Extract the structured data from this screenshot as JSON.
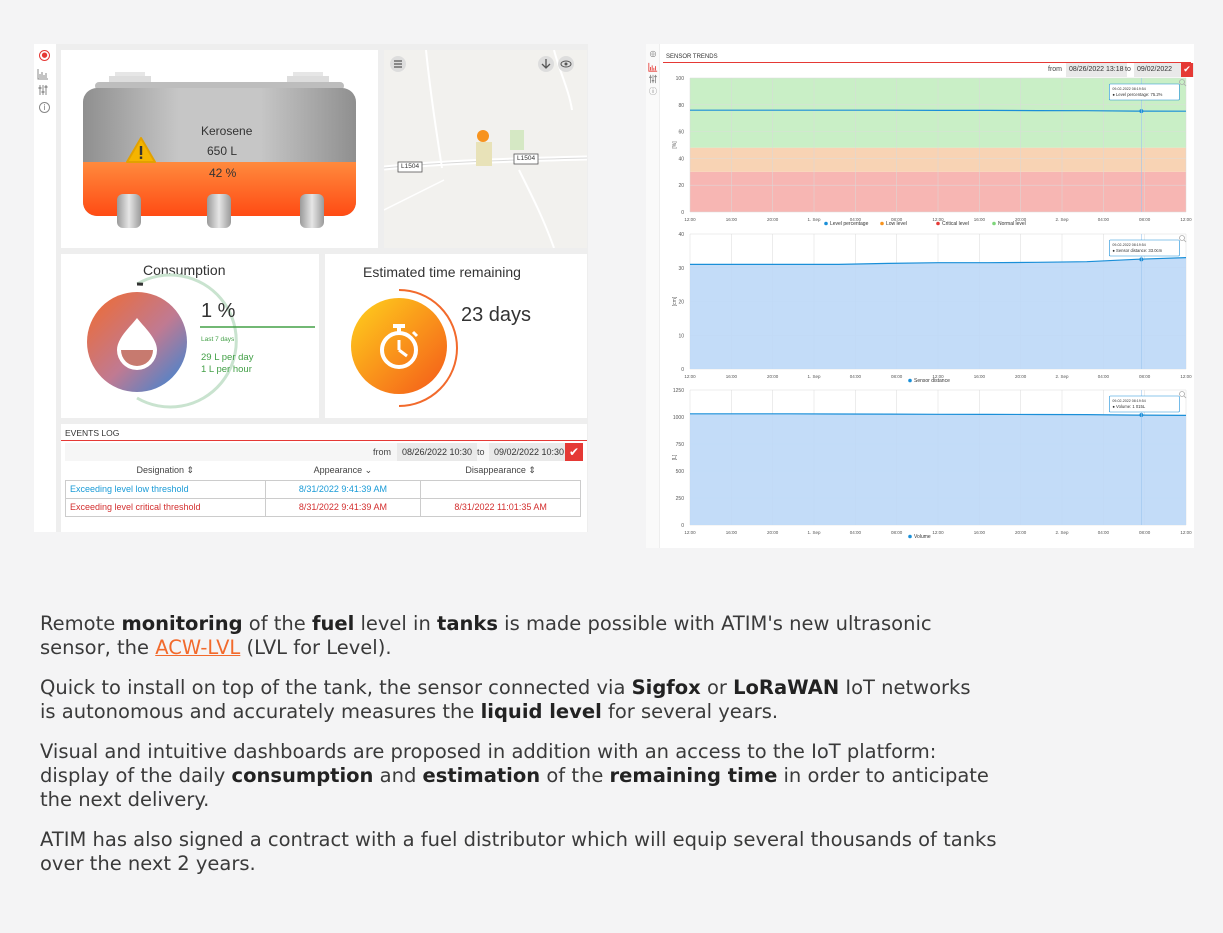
{
  "dashboard": {
    "tank": {
      "product": "Kerosene",
      "volume": "650 L",
      "percent": "42 %",
      "fill_fraction": 0.42
    },
    "map": {
      "road_label_1": "L1504",
      "road_label_2": "L1504"
    },
    "consumption": {
      "title": "Consumption",
      "percent": "1 %",
      "period": "Last 7 days",
      "per_day": "29 L per day",
      "per_hour": "1 L per hour"
    },
    "remaining": {
      "title": "Estimated time remaining",
      "value": "23 days"
    },
    "events": {
      "title": "EVENTS LOG",
      "from_label": "from",
      "from_value": "08/26/2022 10:30",
      "to_label": "to",
      "to_value": "09/02/2022 10:30",
      "columns": [
        "Designation ⇕",
        "Appearance ⌄",
        "Disappearance ⇕"
      ],
      "rows": [
        {
          "designation": "Exceeding level low threshold",
          "appearance": "8/31/2022 9:41:39 AM",
          "disappearance": "",
          "color": "#1a9bd7"
        },
        {
          "designation": "Exceeding level critical threshold",
          "appearance": "8/31/2022 9:41:39 AM",
          "disappearance": "8/31/2022 11:01:35 AM",
          "color": "#d32f2f"
        }
      ]
    }
  },
  "trends": {
    "title": "SENSOR TRENDS",
    "from_label": "from",
    "from_value": "08/26/2022 13:18",
    "to_label": "to",
    "to_value": "09/02/2022 13:18",
    "x_ticks": [
      "12:00",
      "16:00",
      "20:00",
      "1. Sep",
      "04:00",
      "08:00",
      "12:00",
      "16:00",
      "20:00",
      "2. Sep",
      "04:00",
      "08:00",
      "12:00"
    ]
  },
  "chart_data": [
    {
      "type": "line",
      "ylabel": "[%]",
      "ylim": [
        0,
        100
      ],
      "yticks": [
        0,
        20,
        40,
        60,
        80,
        100
      ],
      "bands": [
        {
          "from": 0,
          "to": 30,
          "color": "#f7b6b3"
        },
        {
          "from": 30,
          "to": 48,
          "color": "#f8d3b4"
        },
        {
          "from": 48,
          "to": 100,
          "color": "#c9efc6"
        }
      ],
      "x": [
        0,
        0.1,
        0.2,
        0.3,
        0.4,
        0.5,
        0.6,
        0.7,
        0.8,
        0.9,
        1
      ],
      "series": [
        {
          "name": "Level percentage",
          "values": [
            76,
            76,
            76,
            76,
            76,
            75.8,
            75.8,
            75.7,
            75.6,
            75.3,
            75.2
          ]
        }
      ],
      "legend": [
        "Level percentage",
        "Low level",
        "Critical level",
        "Normal level"
      ],
      "legend_colors": [
        "#1a8fd8",
        "#f7931e",
        "#e53935",
        "#7ed67a"
      ],
      "tooltip": [
        "09-02-2022 08:19:54",
        "● Level percentage: 75.2%"
      ]
    },
    {
      "type": "area",
      "ylabel": "[cm]",
      "ylim": [
        0,
        40
      ],
      "yticks": [
        0,
        10,
        20,
        30,
        40
      ],
      "x": [
        0,
        0.1,
        0.2,
        0.3,
        0.4,
        0.5,
        0.6,
        0.7,
        0.8,
        0.9,
        1
      ],
      "series": [
        {
          "name": "Sensor distance",
          "values": [
            31,
            31,
            31,
            31,
            31.3,
            31.5,
            31.5,
            31.6,
            31.8,
            32.5,
            33
          ]
        }
      ],
      "legend": [
        "Sensor distance"
      ],
      "legend_colors": [
        "#1a8fd8"
      ],
      "tooltip": [
        "09-02-2022 08:19:54",
        "● Sensor distance: 33.0cm"
      ]
    },
    {
      "type": "area",
      "ylabel": "[L]",
      "ylim": [
        0,
        1250
      ],
      "yticks": [
        0,
        250,
        500,
        750,
        1000,
        1250
      ],
      "x": [
        0,
        0.1,
        0.2,
        0.3,
        0.4,
        0.5,
        0.6,
        0.7,
        0.8,
        0.9,
        1
      ],
      "series": [
        {
          "name": "Volume",
          "values": [
            1030,
            1030,
            1030,
            1028,
            1027,
            1025,
            1024,
            1023,
            1022,
            1018,
            1015
          ]
        }
      ],
      "legend": [
        "Volume"
      ],
      "legend_colors": [
        "#1a8fd8"
      ],
      "tooltip": [
        "09-02-2022 08:19:54",
        "● Volume: 1 015L"
      ]
    }
  ],
  "article": {
    "lines": [
      [
        [
          "Remote ",
          false
        ],
        [
          "monitoring",
          true
        ],
        [
          " of the ",
          false
        ],
        [
          "fuel",
          true
        ],
        [
          " level in ",
          false
        ],
        [
          "tanks",
          true
        ],
        [
          " is made possible with ATIM's new ultrasonic",
          false
        ]
      ],
      [
        [
          "sensor, the ",
          false
        ],
        [
          "ACW-LVL",
          "link"
        ],
        [
          " (LVL for Level).",
          false
        ]
      ],
      [
        [
          "Quick to install on top of the tank, the sensor connected via ",
          false
        ],
        [
          "Sigfox",
          true
        ],
        [
          " or ",
          false
        ],
        [
          "LoRaWAN",
          true
        ],
        [
          " IoT networks",
          false
        ]
      ],
      [
        [
          "is autonomous and accurately measures the ",
          false
        ],
        [
          "liquid level",
          true
        ],
        [
          " for several years.",
          false
        ]
      ],
      [
        [
          "Visual and intuitive dashboards are proposed in addition with an access to the IoT platform:",
          false
        ]
      ],
      [
        [
          "display of the daily ",
          false
        ],
        [
          "consumption",
          true
        ],
        [
          " and ",
          false
        ],
        [
          "estimation",
          true
        ],
        [
          " of the ",
          false
        ],
        [
          "remaining time",
          true
        ],
        [
          " in order to anticipate",
          false
        ]
      ],
      [
        [
          "the next delivery.",
          false
        ]
      ],
      [
        [
          "ATIM has also signed a contract with a fuel distributor which will equip several thousands of tanks",
          false
        ]
      ],
      [
        [
          "over the next 2 years.",
          false
        ]
      ]
    ]
  },
  "colors": {
    "accent_red": "#e53935",
    "accent_orange": "#f26a2c",
    "link": "#f26a2c",
    "series_blue": "#1a8fd8"
  }
}
